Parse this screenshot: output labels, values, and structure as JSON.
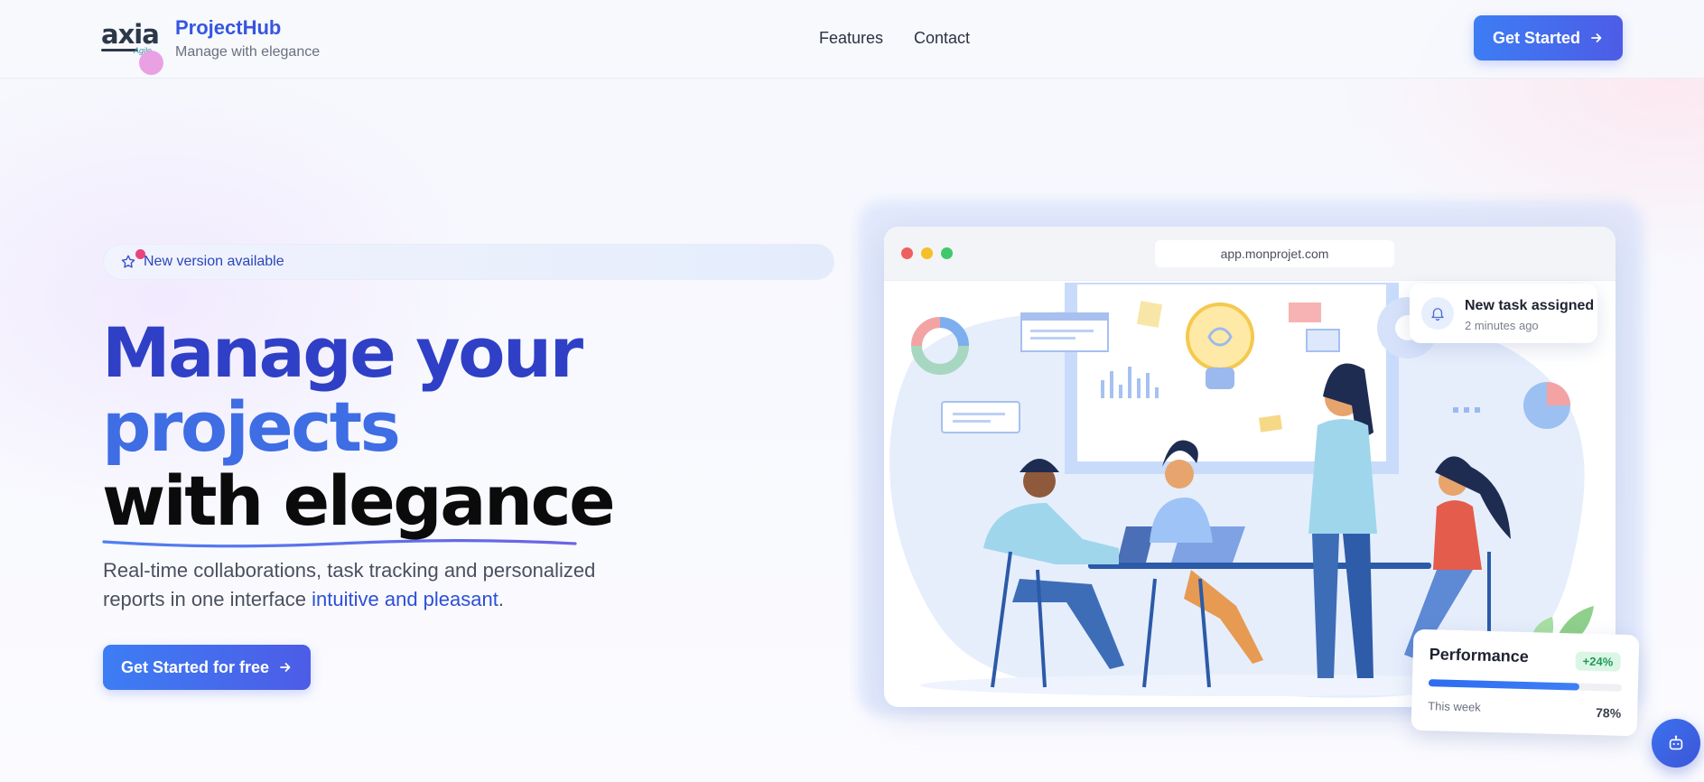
{
  "header": {
    "logo": {
      "word": "axia",
      "sub": "Agile"
    },
    "brand_name": "ProjectHub",
    "tagline": "Manage with elegance",
    "nav": [
      {
        "label": "Features"
      },
      {
        "label": "Contact"
      }
    ],
    "cta_label": "Get Started"
  },
  "hero": {
    "badge_text": "New version available",
    "headline": {
      "line1": "Manage your",
      "line2": "projects",
      "line3": "with elegance"
    },
    "subtitle_part1": "Real-time collaborations, task tracking and personalized reports in one interface ",
    "subtitle_accent": "intuitive and pleasant",
    "subtitle_end": ".",
    "cta_label": "Get Started for free"
  },
  "mockup": {
    "url": "app.monprojet.com",
    "window_dots": [
      "#ef5f5f",
      "#f5bf2a",
      "#3ec96a"
    ]
  },
  "notification": {
    "title": "New task assigned",
    "time": "2 minutes ago"
  },
  "performance": {
    "title": "Performance",
    "badge": "+24%",
    "period": "This week",
    "value_label": "78%",
    "progress_fraction": 0.78
  },
  "icons": {
    "arrow": "arrow-right-icon",
    "star": "star-icon",
    "bell": "bell-icon",
    "bot": "chatbot-icon"
  },
  "colors": {
    "brand": "#3656e0",
    "accent": "#2c4fd8",
    "success": "#1e9a55",
    "badge_dot": "#e8457d"
  }
}
